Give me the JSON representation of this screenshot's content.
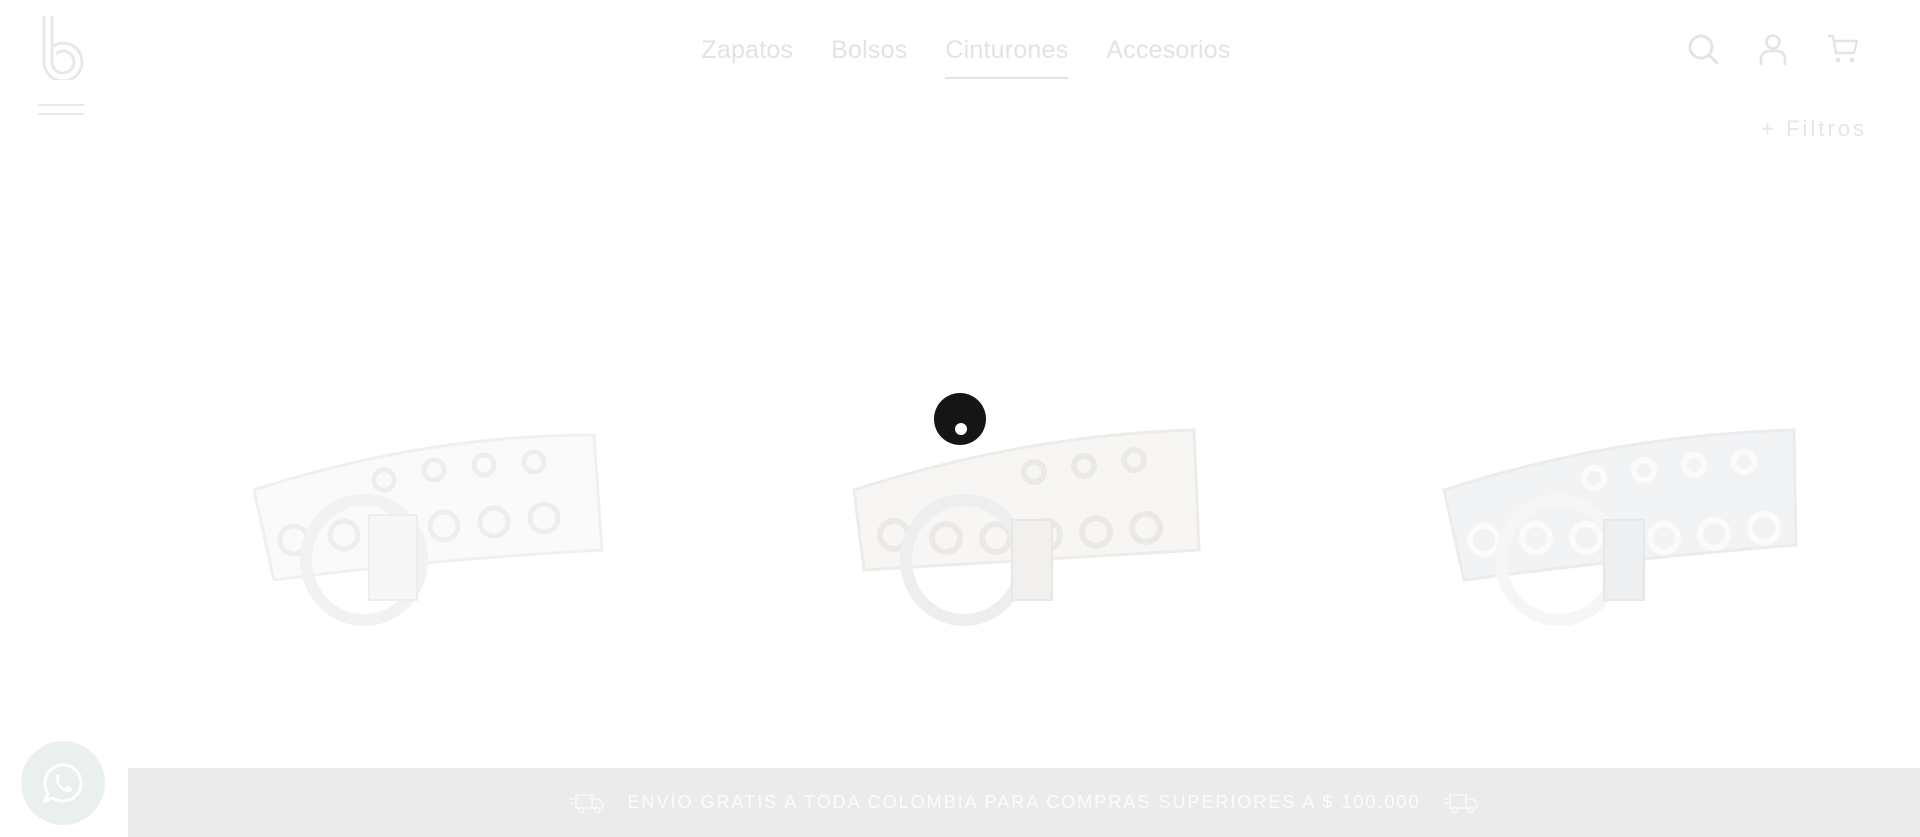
{
  "nav": {
    "items": [
      {
        "label": "Zapatos",
        "active": false
      },
      {
        "label": "Bolsos",
        "active": false
      },
      {
        "label": "Cinturones",
        "active": true
      },
      {
        "label": "Accesorios",
        "active": false
      }
    ]
  },
  "header": {
    "icons": [
      "search-icon",
      "user-icon",
      "cart-icon"
    ]
  },
  "filters": {
    "label": "+ Filtros"
  },
  "products": [
    {
      "color": "white"
    },
    {
      "color": "beige"
    },
    {
      "color": "black"
    }
  ],
  "banner": {
    "text": "ENVÍO GRATIS A TODA COLOMBIA PARA COMPRAS SUPERIORES A $ 100.000"
  },
  "colors": {
    "faded_text": "#e3e3e3",
    "banner_bg": "#ebebeb",
    "loader": "#151515"
  }
}
